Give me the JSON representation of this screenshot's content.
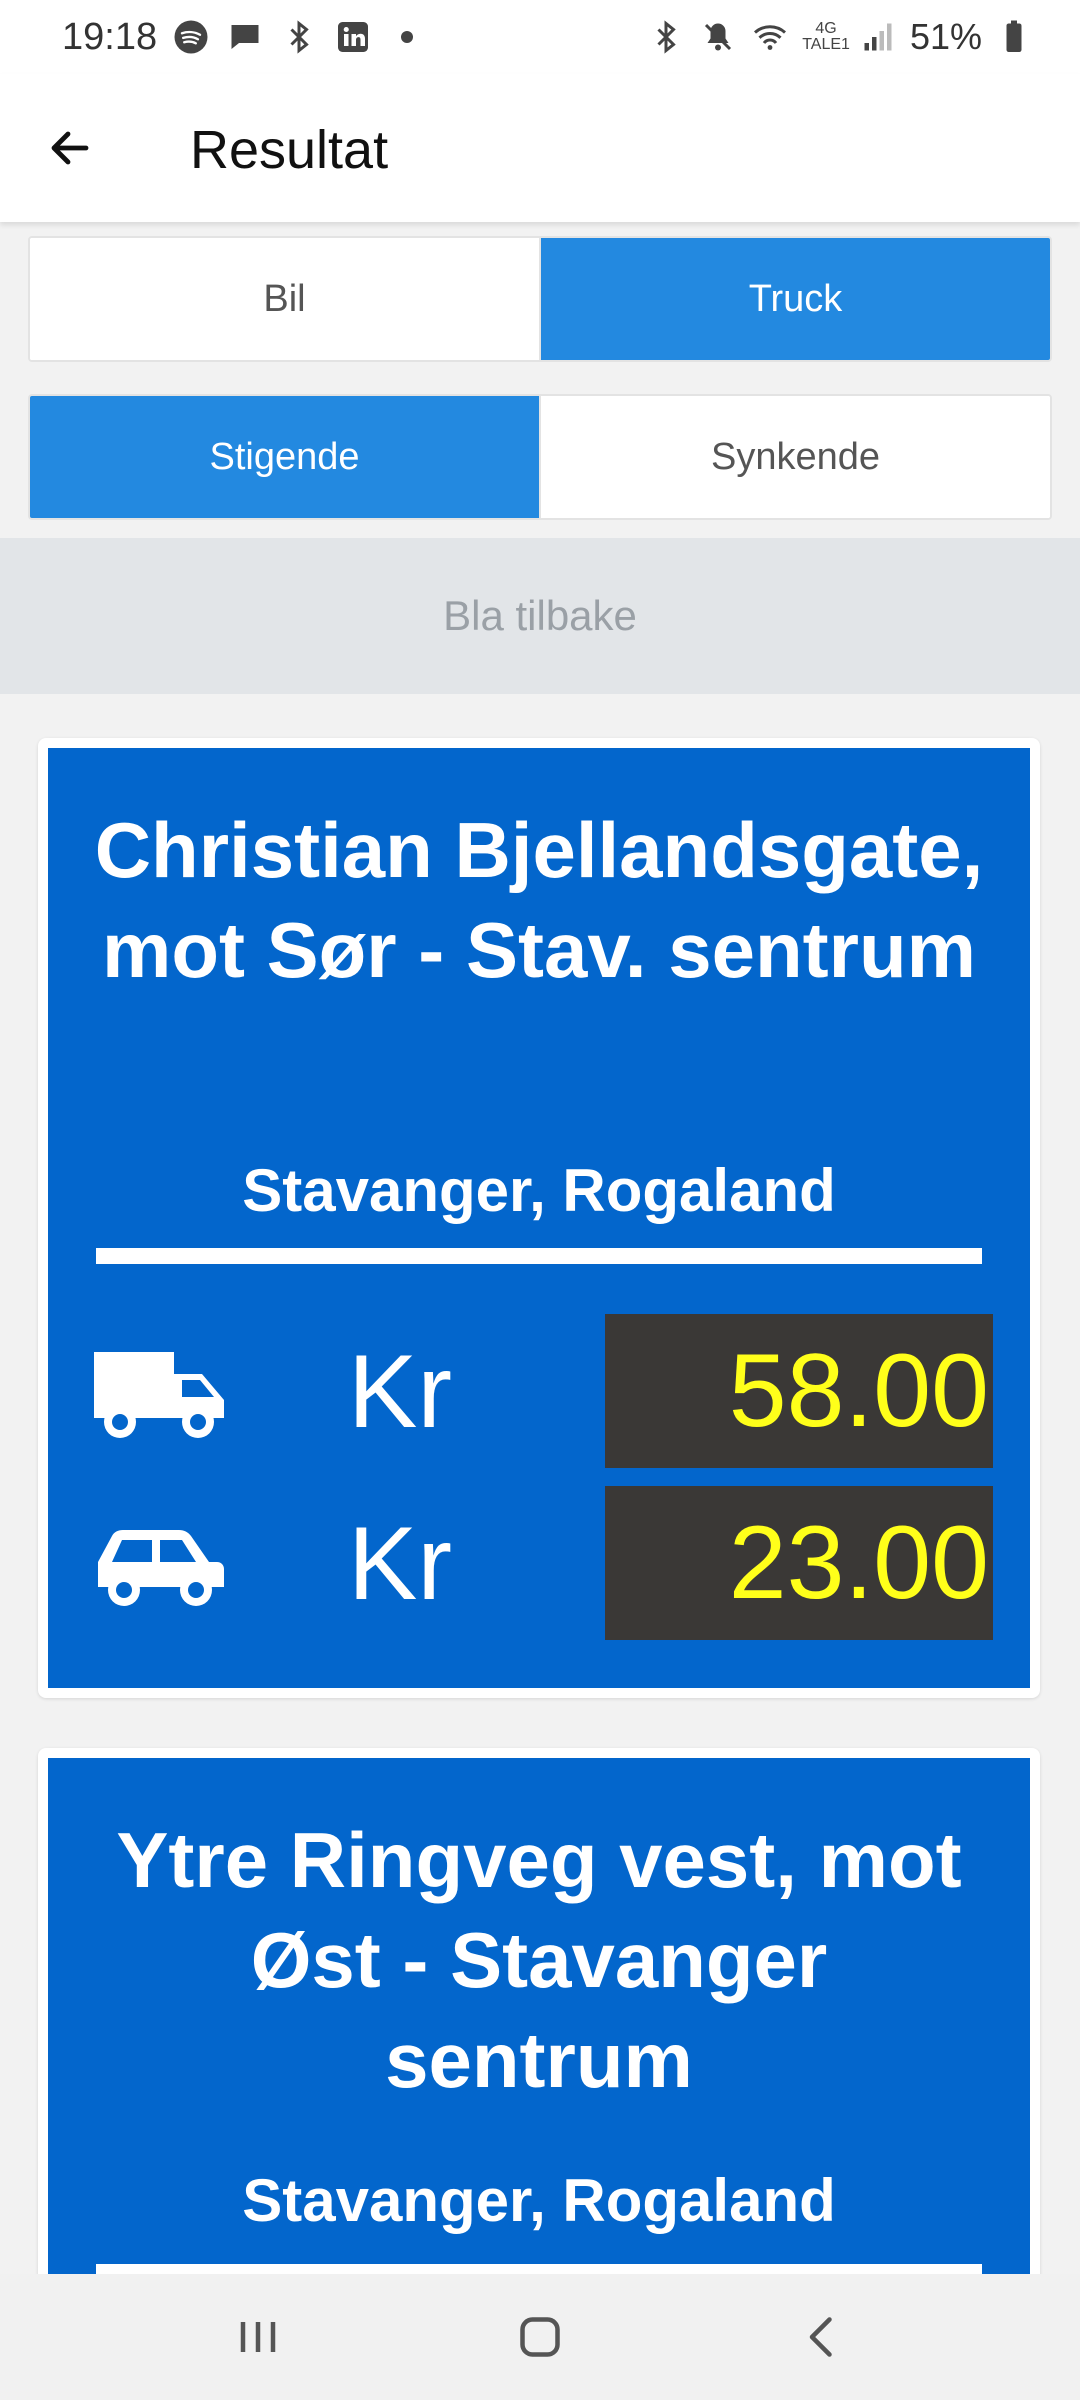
{
  "status_bar": {
    "time": "19:18",
    "left_icons": [
      "spotify-icon",
      "message-icon",
      "bluetooth-icon",
      "linkedin-icon",
      "dot-icon"
    ],
    "right_icons": [
      "bluetooth-icon",
      "mute-icon",
      "wifi-icon",
      "signal-icon",
      "battery-icon"
    ],
    "network_top": "4G",
    "network_bottom": "TALE1",
    "battery": "51%"
  },
  "app_bar": {
    "title": "Resultat",
    "back_icon": "arrow-left-icon"
  },
  "vehicle_toggle": {
    "options": [
      {
        "label": "Bil",
        "active": false
      },
      {
        "label": "Truck",
        "active": true
      }
    ]
  },
  "sort_toggle": {
    "options": [
      {
        "label": "Stigende",
        "active": true
      },
      {
        "label": "Synkende",
        "active": false
      }
    ]
  },
  "browse_back": {
    "label": "Bla tilbake"
  },
  "results": [
    {
      "title": "Christian Bjellandsgate, mot Sør - Stav. sentrum",
      "location": "Stavanger, Rogaland",
      "prices": [
        {
          "vehicle_icon": "truck-icon",
          "currency": "Kr",
          "amount": "58.00"
        },
        {
          "vehicle_icon": "car-icon",
          "currency": "Kr",
          "amount": "23.00"
        }
      ]
    },
    {
      "title": "Ytre Ringveg vest, mot Øst - Stavanger sentrum",
      "location": "Stavanger, Rogaland"
    }
  ],
  "colors": {
    "accent": "#2389e0",
    "card_bg": "#0366cc",
    "price_box": "#3a3836",
    "price_text": "#ffff1a"
  },
  "nav_bar": {
    "icons": [
      "recent-apps-icon",
      "home-icon",
      "back-icon"
    ]
  }
}
